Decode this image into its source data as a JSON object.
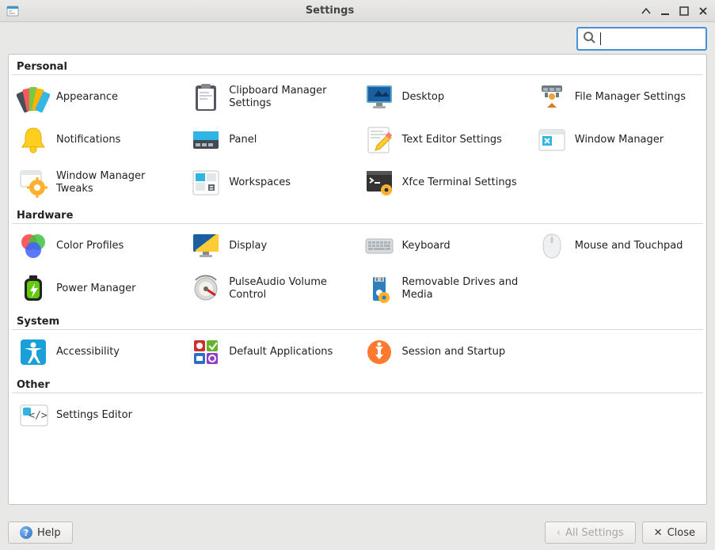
{
  "window": {
    "title": "Settings"
  },
  "search": {
    "placeholder": "",
    "value": ""
  },
  "sections": {
    "personal": {
      "header": "Personal",
      "items": [
        {
          "label": "Appearance",
          "icon": "appearance"
        },
        {
          "label": "Clipboard Manager Settings",
          "icon": "clipboard"
        },
        {
          "label": "Desktop",
          "icon": "desktop"
        },
        {
          "label": "File Manager Settings",
          "icon": "filemanager"
        },
        {
          "label": "Notifications",
          "icon": "notifications"
        },
        {
          "label": "Panel",
          "icon": "panel"
        },
        {
          "label": "Text Editor Settings",
          "icon": "texteditor"
        },
        {
          "label": "Window Manager",
          "icon": "wm"
        },
        {
          "label": "Window Manager Tweaks",
          "icon": "wmtweaks"
        },
        {
          "label": "Workspaces",
          "icon": "workspaces"
        },
        {
          "label": "Xfce Terminal Settings",
          "icon": "terminal"
        }
      ]
    },
    "hardware": {
      "header": "Hardware",
      "items": [
        {
          "label": "Color Profiles",
          "icon": "color"
        },
        {
          "label": "Display",
          "icon": "display"
        },
        {
          "label": "Keyboard",
          "icon": "keyboard"
        },
        {
          "label": "Mouse and Touchpad",
          "icon": "mouse"
        },
        {
          "label": "Power Manager",
          "icon": "power"
        },
        {
          "label": "PulseAudio Volume Control",
          "icon": "pulseaudio"
        },
        {
          "label": "Removable Drives and Media",
          "icon": "removable"
        }
      ]
    },
    "system": {
      "header": "System",
      "items": [
        {
          "label": "Accessibility",
          "icon": "accessibility"
        },
        {
          "label": "Default Applications",
          "icon": "default-apps"
        },
        {
          "label": "Session and Startup",
          "icon": "session"
        }
      ]
    },
    "other": {
      "header": "Other",
      "items": [
        {
          "label": "Settings Editor",
          "icon": "settings-editor"
        }
      ]
    }
  },
  "footer": {
    "help": "Help",
    "all_settings": "All Settings",
    "close": "Close"
  }
}
